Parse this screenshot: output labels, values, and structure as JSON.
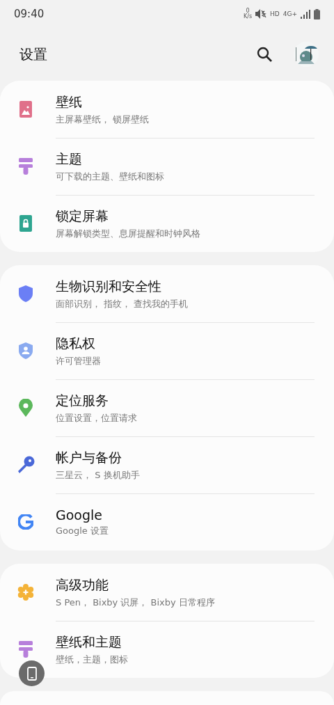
{
  "status_bar": {
    "time": "09:40",
    "net_speed": "0",
    "net_unit": "K/s",
    "hd": "HD",
    "network": "4G+"
  },
  "header": {
    "title": "设置"
  },
  "groups": [
    {
      "items": [
        {
          "kind": "wallpaper",
          "color": "#e0708a",
          "title": "壁纸",
          "subtitle": "主屏幕壁纸， 锁屏壁纸"
        },
        {
          "kind": "brush",
          "color": "#b77fdb",
          "title": "主题",
          "subtitle": "可下载的主题、壁纸和图标"
        },
        {
          "kind": "lock",
          "color": "#2ea590",
          "title": "锁定屏幕",
          "subtitle": "屏幕解锁类型、息屏提醒和时钟风格"
        }
      ]
    },
    {
      "items": [
        {
          "kind": "shield",
          "color": "#6b7ff5",
          "title": "生物识别和安全性",
          "subtitle": "面部识别， 指纹， 查找我的手机"
        },
        {
          "kind": "privacy",
          "color": "#8aaaf0",
          "title": "隐私权",
          "subtitle": "许可管理器"
        },
        {
          "kind": "pin",
          "color": "#5cb85c",
          "title": "定位服务",
          "subtitle": "位置设置，位置请求"
        },
        {
          "kind": "key",
          "color": "#4a68d8",
          "title": "帐户与备份",
          "subtitle": "三星云， S 换机助手"
        },
        {
          "kind": "google",
          "color": "#4285f4",
          "title": "Google",
          "subtitle": "Google 设置"
        }
      ]
    },
    {
      "items": [
        {
          "kind": "gear",
          "color": "#f4b338",
          "title": "高级功能",
          "subtitle": "S Pen， Bixby 识屏， Bixby 日常程序"
        },
        {
          "kind": "brush",
          "color": "#b77fdb",
          "title": "壁纸和主题",
          "subtitle": "壁纸，主题，图标"
        }
      ]
    }
  ]
}
